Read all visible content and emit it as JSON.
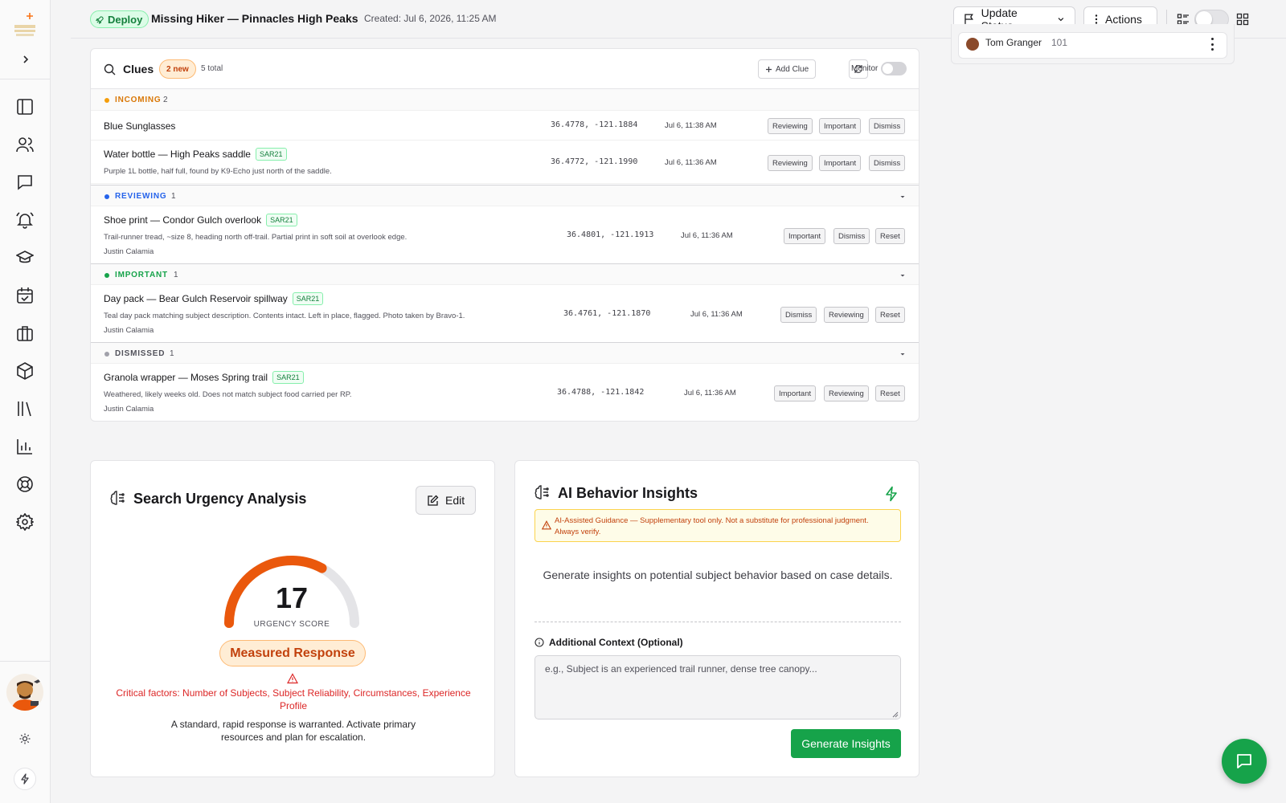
{
  "header": {
    "deploy_label": "Deploy",
    "case_title": "Missing Hiker — Pinnacles High Peaks",
    "created": "Created: Jul 6, 2026, 11:25 AM",
    "update_status_label": "Update Status",
    "actions_label": "Actions"
  },
  "personnel": {
    "name": "Tom Granger",
    "number": "101"
  },
  "clues": {
    "title": "Clues",
    "new_badge": "2 new",
    "total": "5 total",
    "add_label": "Add Clue",
    "monitor_label": "Monitor",
    "sections": [
      {
        "label": "INCOMING",
        "count": "2",
        "color": "#f59e0b",
        "label_color": "#d97706"
      },
      {
        "label": "REVIEWING",
        "count": "1",
        "color": "#2563eb",
        "label_color": "#2563eb"
      },
      {
        "label": "IMPORTANT",
        "count": "1",
        "color": "#16a34a",
        "label_color": "#16a34a"
      },
      {
        "label": "DISMISSED",
        "count": "1",
        "color": "#a1a1aa",
        "label_color": "#52525b"
      }
    ],
    "items": [
      {
        "title": "Blue Sunglasses",
        "coords": "36.4778, -121.1884",
        "time": "Jul 6, 11:38 AM",
        "actions": [
          "Reviewing",
          "Important",
          "Dismiss"
        ]
      },
      {
        "title": "Water bottle — High Peaks saddle",
        "tag": "SAR21",
        "desc": "Purple 1L bottle, half full, found by K9-Echo just north of the saddle.",
        "coords": "36.4772, -121.1990",
        "time": "Jul 6, 11:36 AM",
        "actions": [
          "Reviewing",
          "Important",
          "Dismiss"
        ]
      },
      {
        "title": "Shoe print — Condor Gulch overlook",
        "tag": "SAR21",
        "desc": "Trail-runner tread, ~size 8, heading north off-trail. Partial print in soft soil at overlook edge.",
        "author": "Justin Calamia",
        "coords": "36.4801, -121.1913",
        "time": "Jul 6, 11:36 AM",
        "actions": [
          "Important",
          "Dismiss",
          "Reset"
        ]
      },
      {
        "title": "Day pack — Bear Gulch Reservoir spillway",
        "tag": "SAR21",
        "desc": "Teal day pack matching subject description. Contents intact. Left in place, flagged. Photo taken by Bravo-1.",
        "author": "Justin Calamia",
        "coords": "36.4761, -121.1870",
        "time": "Jul 6, 11:36 AM",
        "actions": [
          "Dismiss",
          "Reviewing",
          "Reset"
        ]
      },
      {
        "title": "Granola wrapper — Moses Spring trail",
        "tag": "SAR21",
        "desc": "Weathered, likely weeks old. Does not match subject food carried per RP.",
        "author": "Justin Calamia",
        "coords": "36.4788, -121.1842",
        "time": "Jul 6, 11:36 AM",
        "actions": [
          "Important",
          "Reviewing",
          "Reset"
        ]
      }
    ]
  },
  "urgency": {
    "title": "Search Urgency Analysis",
    "edit_label": "Edit",
    "score": 17,
    "score_fraction": 0.66,
    "score_label": "URGENCY SCORE",
    "level": "Measured Response",
    "critical": "Critical factors: Number of Subjects, Subject Reliability, Circumstances, Experience Profile",
    "description": "A standard, rapid response is warranted. Activate primary resources and plan for escalation."
  },
  "insights": {
    "title": "AI Behavior Insights",
    "warning": "AI-Assisted Guidance — Supplementary tool only. Not a substitute for professional judgment. Always verify.",
    "prompt": "Generate insights on potential subject behavior based on case details.",
    "context_label": "Additional Context (Optional)",
    "context_placeholder": "e.g., Subject is an experienced trail runner, dense tree canopy...",
    "button_label": "Generate Insights"
  },
  "colors": {
    "accent_green": "#16a34a",
    "gauge_orange": "#ea580c",
    "warning_orange": "#c2410c"
  }
}
